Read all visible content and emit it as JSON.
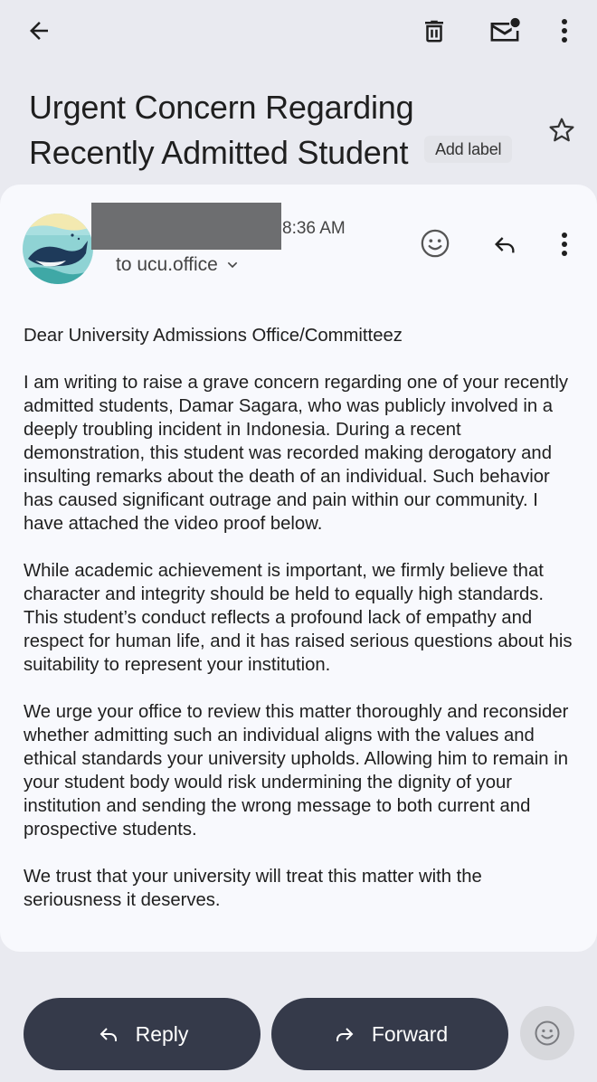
{
  "toolbar": {
    "back_icon": "arrow-left-icon",
    "delete_icon": "trash-icon",
    "mark_unread_icon": "mail-unread-icon",
    "more_icon": "more-vertical-icon"
  },
  "email": {
    "subject": "Urgent Concern Regarding Recently Admitted Student",
    "add_label": "Add label",
    "time": "8:36 AM",
    "recipient": "to ucu.office",
    "body": [
      "Dear University Admissions Office/Committeez",
      "I am writing to raise a grave concern regarding one of your recently admitted students, Damar Sagara, who was publicly involved in a deeply troubling incident in Indonesia. During a recent demonstration, this student was recorded making derogatory and insulting remarks about the death of an individual. Such behavior has caused significant outrage and pain within our community. I have attached the video proof below.",
      "While academic achievement is important, we firmly believe that character and integrity should be held to equally high standards. This student’s conduct reflects a profound lack of empathy and respect for human life, and it has raised serious questions about his suitability to represent your institution.",
      "We urge your office to review this matter thoroughly and reconsider whether admitting such an individual aligns with the values and ethical standards your university upholds. Allowing him to remain in your student body would risk undermining the dignity of your institution and sending the wrong message to both current and prospective students.",
      "We trust that your university will treat this matter with the seriousness it deserves."
    ]
  },
  "actions": {
    "reply_label": "Reply",
    "forward_label": "Forward"
  },
  "colors": {
    "background": "#e9eaf0",
    "card": "#f8f9fd",
    "pill": "#353a4a"
  }
}
